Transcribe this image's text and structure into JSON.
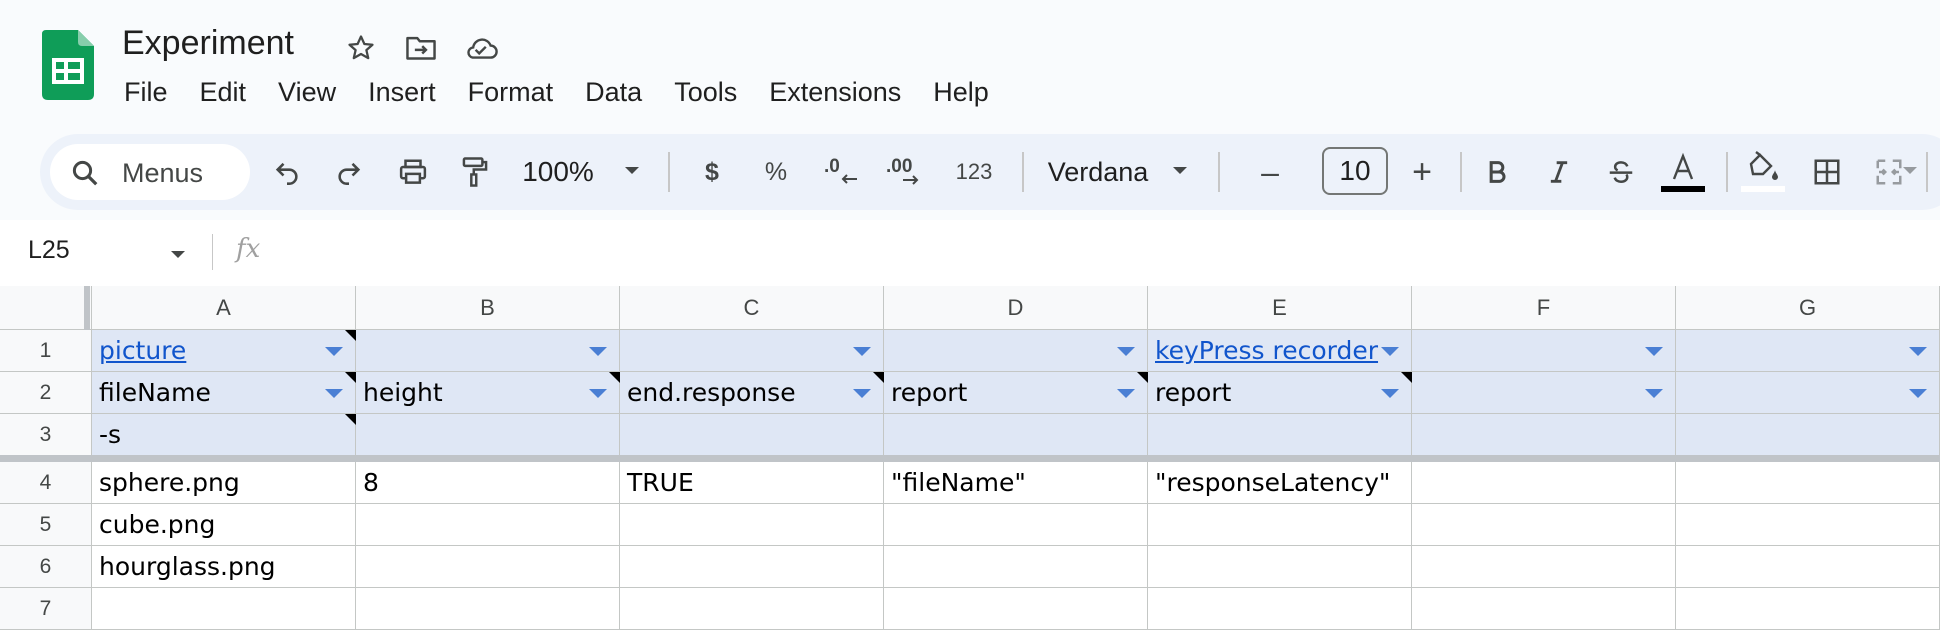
{
  "document": {
    "title": "Experiment"
  },
  "menu": [
    "File",
    "Edit",
    "View",
    "Insert",
    "Format",
    "Data",
    "Tools",
    "Extensions",
    "Help"
  ],
  "toolbar": {
    "search_label": "Menus",
    "zoom": "100%",
    "currency": "$",
    "percent": "%",
    "decrease_decimals": ".0",
    "increase_decimals": ".00",
    "number_format": "123",
    "font": "Verdana",
    "font_size": "10",
    "minus": "–",
    "plus": "+"
  },
  "formula_bar": {
    "cell_ref": "L25",
    "fx": "fx",
    "content": ""
  },
  "colors": {
    "header_fill": "#dfe7f5",
    "link": "#1155cc",
    "filter_arrow": "#4a7fd4"
  },
  "columns": [
    "A",
    "B",
    "C",
    "D",
    "E",
    "F",
    "G"
  ],
  "rows": [
    {
      "num": "1",
      "cells": [
        "picture",
        "",
        "",
        "",
        "keyPress recorder",
        "",
        ""
      ]
    },
    {
      "num": "2",
      "cells": [
        "fileName",
        "height",
        "end.response",
        "report",
        "report",
        "",
        ""
      ]
    },
    {
      "num": "3",
      "cells": [
        "-s",
        "",
        "",
        "",
        "",
        "",
        ""
      ]
    },
    {
      "num": "4",
      "cells": [
        "sphere.png",
        "8",
        "TRUE",
        "\"fileName\"",
        "\"responseLatency\"",
        "",
        ""
      ]
    },
    {
      "num": "5",
      "cells": [
        "cube.png",
        "",
        "",
        "",
        "",
        "",
        ""
      ]
    },
    {
      "num": "6",
      "cells": [
        "hourglass.png",
        "",
        "",
        "",
        "",
        "",
        ""
      ]
    },
    {
      "num": "7",
      "cells": [
        "",
        "",
        "",
        "",
        "",
        "",
        ""
      ]
    }
  ]
}
